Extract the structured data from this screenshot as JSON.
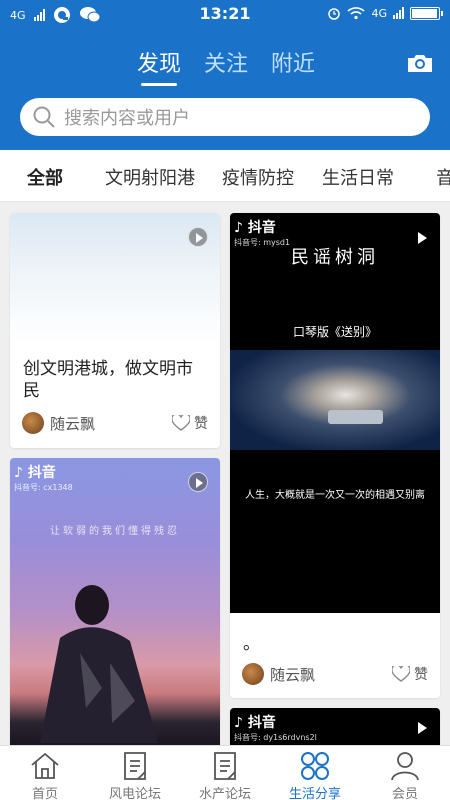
{
  "status_bar": {
    "network_left": "4G",
    "time": "13:21",
    "network_right": "4G"
  },
  "top_tabs": [
    {
      "label": "发现",
      "active": true
    },
    {
      "label": "关注",
      "active": false
    },
    {
      "label": "附近",
      "active": false
    }
  ],
  "search": {
    "placeholder": "搜索内容或用户"
  },
  "categories": [
    "全部",
    "文明射阳港",
    "疫情防控",
    "生活日常",
    "音"
  ],
  "cards": {
    "card1": {
      "title": "创文明港城，做文明市民",
      "author": "随云飘",
      "like_label": "赞"
    },
    "card2": {
      "douyin_label": "抖音",
      "douyin_id": "抖音号: mysd1",
      "video_title": "民谣树洞",
      "video_subtitle": "口琴版《送别》",
      "video_caption": "人生，大概就是一次又一次的相遇又别离",
      "title": "。",
      "author": "随云飘",
      "like_label": "赞"
    },
    "card3": {
      "douyin_label": "抖音",
      "douyin_id": "抖音号: cx1348",
      "video_caption": "让软弱的我们懂得残忍"
    },
    "card4": {
      "douyin_label": "抖音",
      "douyin_id": "抖音号: dy1s6rdvns2l"
    }
  },
  "bottom_nav": [
    {
      "label": "首页",
      "icon": "home-icon",
      "active": false
    },
    {
      "label": "风电论坛",
      "icon": "document-icon",
      "active": false
    },
    {
      "label": "水产论坛",
      "icon": "document-icon",
      "active": false
    },
    {
      "label": "生活分享",
      "icon": "grid-circles-icon",
      "active": true
    },
    {
      "label": "会员",
      "icon": "person-icon",
      "active": false
    }
  ],
  "colors": {
    "accent": "#1b73c9",
    "background": "#efefef"
  }
}
